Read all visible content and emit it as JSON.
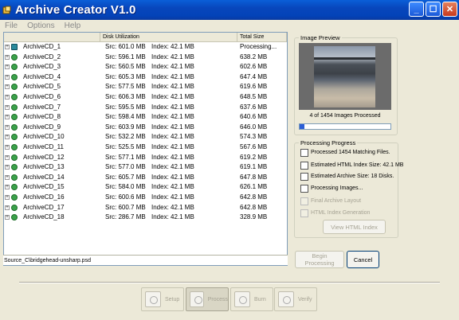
{
  "window": {
    "title": "Archive Creator V1.0"
  },
  "menu": [
    "File",
    "Options",
    "Help"
  ],
  "list": {
    "columns": {
      "disk": "Disk Utilization",
      "total": "Total Size"
    },
    "rows": [
      {
        "name": "ArchiveCD_1",
        "src": "Src: 601.0 MB",
        "idx": "Index: 42.1 MB",
        "total": "Processing..."
      },
      {
        "name": "ArchiveCD_2",
        "src": "Src: 596.1 MB",
        "idx": "Index: 42.1 MB",
        "total": "638.2 MB"
      },
      {
        "name": "ArchiveCD_3",
        "src": "Src: 560.5 MB",
        "idx": "Index: 42.1 MB",
        "total": "602.6 MB"
      },
      {
        "name": "ArchiveCD_4",
        "src": "Src: 605.3 MB",
        "idx": "Index: 42.1 MB",
        "total": "647.4 MB"
      },
      {
        "name": "ArchiveCD_5",
        "src": "Src: 577.5 MB",
        "idx": "Index: 42.1 MB",
        "total": "619.6 MB"
      },
      {
        "name": "ArchiveCD_6",
        "src": "Src: 606.3 MB",
        "idx": "Index: 42.1 MB",
        "total": "648.5 MB"
      },
      {
        "name": "ArchiveCD_7",
        "src": "Src: 595.5 MB",
        "idx": "Index: 42.1 MB",
        "total": "637.6 MB"
      },
      {
        "name": "ArchiveCD_8",
        "src": "Src: 598.4 MB",
        "idx": "Index: 42.1 MB",
        "total": "640.6 MB"
      },
      {
        "name": "ArchiveCD_9",
        "src": "Src: 603.9 MB",
        "idx": "Index: 42.1 MB",
        "total": "646.0 MB"
      },
      {
        "name": "ArchiveCD_10",
        "src": "Src: 532.2 MB",
        "idx": "Index: 42.1 MB",
        "total": "574.3 MB"
      },
      {
        "name": "ArchiveCD_11",
        "src": "Src: 525.5 MB",
        "idx": "Index: 42.1 MB",
        "total": "567.6 MB"
      },
      {
        "name": "ArchiveCD_12",
        "src": "Src: 577.1 MB",
        "idx": "Index: 42.1 MB",
        "total": "619.2 MB"
      },
      {
        "name": "ArchiveCD_13",
        "src": "Src: 577.0 MB",
        "idx": "Index: 42.1 MB",
        "total": "619.1 MB"
      },
      {
        "name": "ArchiveCD_14",
        "src": "Src: 605.7 MB",
        "idx": "Index: 42.1 MB",
        "total": "647.8 MB"
      },
      {
        "name": "ArchiveCD_15",
        "src": "Src: 584.0 MB",
        "idx": "Index: 42.1 MB",
        "total": "626.1 MB"
      },
      {
        "name": "ArchiveCD_16",
        "src": "Src: 600.6 MB",
        "idx": "Index: 42.1 MB",
        "total": "642.8 MB"
      },
      {
        "name": "ArchiveCD_17",
        "src": "Src: 600.7 MB",
        "idx": "Index: 42.1 MB",
        "total": "642.8 MB"
      },
      {
        "name": "ArchiveCD_18",
        "src": "Src: 286.7 MB",
        "idx": "Index: 42.1 MB",
        "total": "328.9 MB"
      }
    ],
    "current_path": "Source_C\\bridgehead-unsharp.psd"
  },
  "preview": {
    "legend": "Image Preview",
    "progress_caption": "4 of 1454 Images Processed",
    "progress_fraction": 0.00275
  },
  "processing": {
    "legend": "Processing Progress",
    "items": [
      {
        "label": "Processed 1454 Matching Files.",
        "enabled": true
      },
      {
        "label": "Estimated HTML Index Size: 42.1 MB",
        "enabled": true
      },
      {
        "label": "Estimated Archive Size: 18 Disks.",
        "enabled": true
      },
      {
        "label": "Processing Images...",
        "enabled": true
      },
      {
        "label": "Final Archive Layout",
        "enabled": false
      },
      {
        "label": "HTML Index Generation",
        "enabled": false
      }
    ],
    "view_html_button": "View HTML Index"
  },
  "actions": {
    "begin": "Begin\nProcessing",
    "cancel": "Cancel"
  },
  "nav": {
    "setup": "Setup",
    "process": "Process",
    "burn": "Burn",
    "verify": "Verify"
  }
}
